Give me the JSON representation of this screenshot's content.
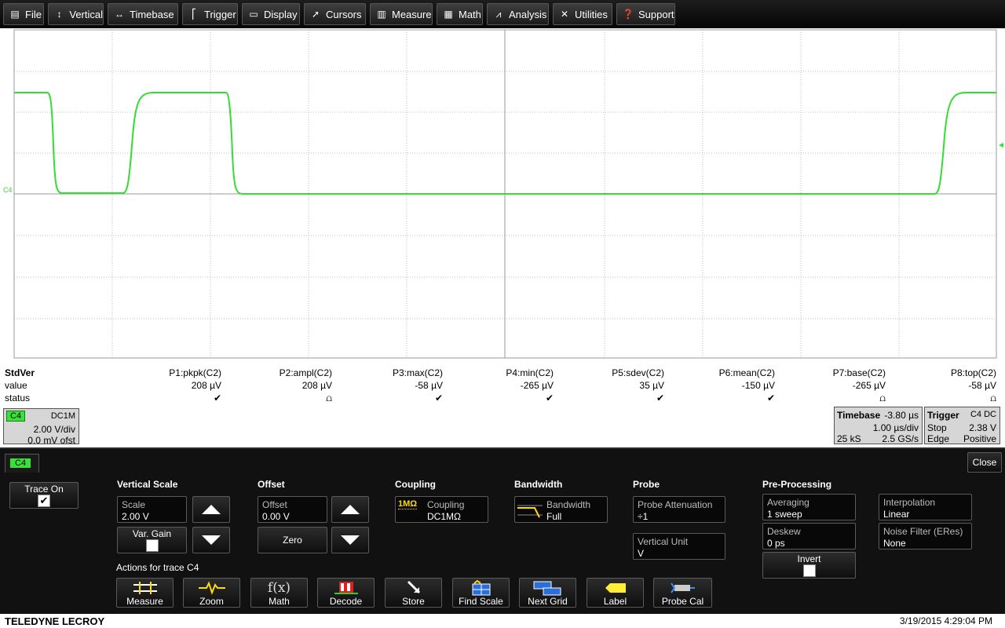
{
  "menu": {
    "file": "File",
    "vertical": "Vertical",
    "timebase": "Timebase",
    "trigger": "Trigger",
    "display": "Display",
    "cursors": "Cursors",
    "measure": "Measure",
    "math": "Math",
    "analysis": "Analysis",
    "utilities": "Utilities",
    "support": "Support"
  },
  "icons": {
    "file": "file-icon",
    "vertical": "updown-arrow-icon",
    "timebase": "leftright-arrow-icon",
    "trigger": "trigger-flag-icon",
    "display": "display-icon",
    "cursors": "cursor-icon",
    "measure": "measure-icon",
    "math": "calculator-icon",
    "analysis": "analysis-icon",
    "utilities": "tools-icon",
    "support": "question-icon"
  },
  "colors": {
    "trace": "#33dd33",
    "channel_badge": "#39e239",
    "grid_line": "#bfbfbf"
  },
  "trace_label": "C4",
  "measurements": {
    "row_labels": {
      "header": "StdVer",
      "value": "value",
      "status": "status"
    },
    "params": [
      {
        "name": "P1:pkpk(C2)",
        "value": "208 µV",
        "status": "✔"
      },
      {
        "name": "P2:ampl(C2)",
        "value": "208 µV",
        "status": "⩍"
      },
      {
        "name": "P3:max(C2)",
        "value": "-58 µV",
        "status": "✔"
      },
      {
        "name": "P4:min(C2)",
        "value": "-265 µV",
        "status": "✔"
      },
      {
        "name": "P5:sdev(C2)",
        "value": "35 µV",
        "status": "✔"
      },
      {
        "name": "P6:mean(C2)",
        "value": "-150 µV",
        "status": "✔"
      },
      {
        "name": "P7:base(C2)",
        "value": "-265 µV",
        "status": "⩍"
      },
      {
        "name": "P8:top(C2)",
        "value": "-58 µV",
        "status": "⩍"
      }
    ]
  },
  "channel_desc": {
    "name": "C4",
    "coupling": "DC1M",
    "scale": "2.00 V/div",
    "offset": "0.0 mV ofst"
  },
  "timebase_desc": {
    "title": "Timebase",
    "delay": "-3.80 µs",
    "per_div": "1.00 µs/div",
    "samples": "25 kS",
    "rate": "2.5 GS/s"
  },
  "trigger_desc": {
    "title": "Trigger",
    "source": "C4 DC",
    "mode": "Stop",
    "level": "2.38 V",
    "type": "Edge",
    "slope": "Positive"
  },
  "dialog": {
    "tab": "C4",
    "close": "Close",
    "trace_on": {
      "label": "Trace On",
      "checked": "✔"
    },
    "vertical_scale": {
      "title": "Vertical Scale",
      "scale_label": "Scale",
      "scale_value": "2.00 V",
      "var_gain": "Var. Gain"
    },
    "offset": {
      "title": "Offset",
      "label": "Offset",
      "value": "0.00 V",
      "zero": "Zero"
    },
    "coupling": {
      "title": "Coupling",
      "label": "Coupling",
      "value": "DC1MΩ",
      "badge": "1MΩ"
    },
    "bandwidth": {
      "title": "Bandwidth",
      "label": "Bandwidth",
      "value": "Full"
    },
    "probe": {
      "title": "Probe",
      "atten_label": "Probe Attenuation",
      "atten_value": "÷1",
      "unit_label": "Vertical Unit",
      "unit_value": "V"
    },
    "preproc": {
      "title": "Pre-Processing",
      "averaging_label": "Averaging",
      "averaging_value": "1 sweep",
      "deskew_label": "Deskew",
      "deskew_value": "0 ps",
      "invert_label": "Invert",
      "interp_label": "Interpolation",
      "interp_value": "Linear",
      "noise_label": "Noise Filter (ERes)",
      "noise_value": "None"
    },
    "actions_title": "Actions for trace C4",
    "actions": [
      "Measure",
      "Zoom",
      "Math",
      "Decode",
      "Store",
      "Find Scale",
      "Next Grid",
      "Label",
      "Probe Cal"
    ]
  },
  "footer": {
    "brand": "TELEDYNE LECROY",
    "datetime": "3/19/2015 4:29:04 PM"
  }
}
